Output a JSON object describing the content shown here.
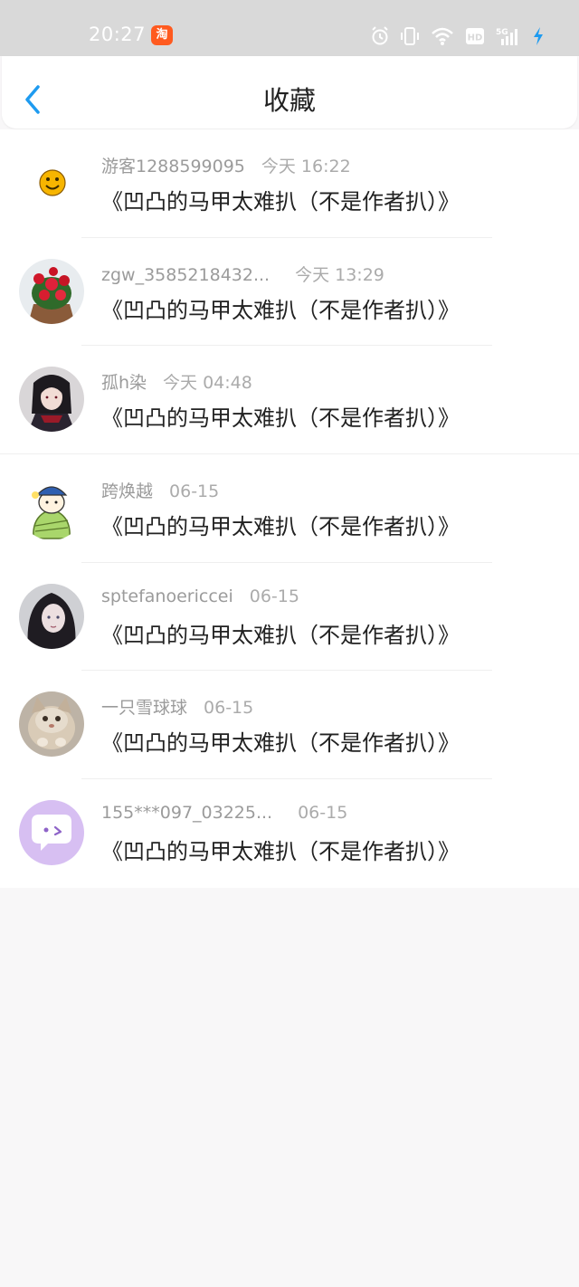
{
  "status_bar": {
    "time": "20:27",
    "app_badge": "淘",
    "icons": [
      "alarm-icon",
      "vibrate-icon",
      "wifi-icon",
      "hd-icon",
      "5g-signal-icon",
      "charging-icon"
    ]
  },
  "header": {
    "back_icon": "chevron-left-icon",
    "title": "收藏",
    "accent": "#1e9bf0"
  },
  "favorites": [
    {
      "user": "游客1288599095",
      "time": "今天 16:22",
      "text": "《凹凸的马甲太难扒（不是作者扒）》",
      "avatar": "smiley-avatar"
    },
    {
      "user": "zgw_3585218432...",
      "time": "今天 13:29",
      "text": "《凹凸的马甲太难扒（不是作者扒）》",
      "avatar": "roses-avatar"
    },
    {
      "user": "孤h染",
      "time": "今天 04:48",
      "text": "《凹凸的马甲太难扒（不是作者扒）》",
      "avatar": "anime-boy-avatar"
    },
    {
      "user": "跨焕越",
      "time": "06-15",
      "text": "《凹凸的马甲太难扒（不是作者扒）》",
      "avatar": "cartoon-avatar"
    },
    {
      "user": "sptefanoericcei",
      "time": "06-15",
      "text": "《凹凸的马甲太难扒（不是作者扒）》",
      "avatar": "anime-girl-avatar"
    },
    {
      "user": "一只雪球球",
      "time": "06-15",
      "text": "《凹凸的马甲太难扒（不是作者扒）》",
      "avatar": "cat-avatar"
    },
    {
      "user": "155***097_03225...",
      "time": "06-15",
      "text": "《凹凸的马甲太难扒（不是作者扒）》",
      "avatar": "chat-bubble-avatar"
    }
  ]
}
